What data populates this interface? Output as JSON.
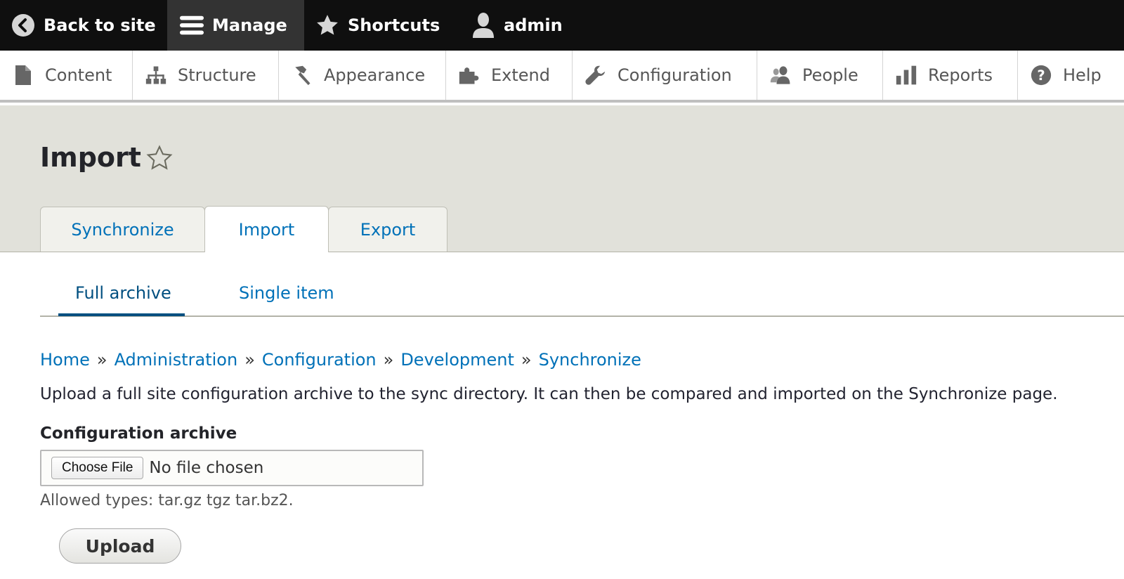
{
  "toolbar": {
    "back_label": "Back to site",
    "manage_label": "Manage",
    "shortcuts_label": "Shortcuts",
    "user_label": "admin"
  },
  "tray": {
    "items": [
      {
        "label": "Content",
        "icon": "content-icon"
      },
      {
        "label": "Structure",
        "icon": "structure-icon"
      },
      {
        "label": "Appearance",
        "icon": "appearance-icon"
      },
      {
        "label": "Extend",
        "icon": "extend-icon"
      },
      {
        "label": "Configuration",
        "icon": "wrench-icon"
      },
      {
        "label": "People",
        "icon": "people-icon"
      },
      {
        "label": "Reports",
        "icon": "reports-icon"
      },
      {
        "label": "Help",
        "icon": "help-icon"
      }
    ]
  },
  "page": {
    "title": "Import",
    "tabs": [
      {
        "label": "Synchronize"
      },
      {
        "label": "Import"
      },
      {
        "label": "Export"
      }
    ],
    "subtabs": [
      {
        "label": "Full archive"
      },
      {
        "label": "Single item"
      }
    ]
  },
  "breadcrumb": [
    "Home",
    "Administration",
    "Configuration",
    "Development",
    "Synchronize"
  ],
  "breadcrumb_separator": "»",
  "content": {
    "description": "Upload a full site configuration archive to the sync directory. It can then be compared and imported on the Synchronize page.",
    "field_label": "Configuration archive",
    "choose_file_label": "Choose File",
    "no_file_text": "No file chosen",
    "allowed_types": "Allowed types: tar.gz tgz tar.bz2.",
    "upload_label": "Upload"
  },
  "colors": {
    "toolbar_bg": "#0f0f0f",
    "header_bg": "#e1e1da",
    "link": "#0071b8",
    "active_subtab": "#004f80"
  }
}
